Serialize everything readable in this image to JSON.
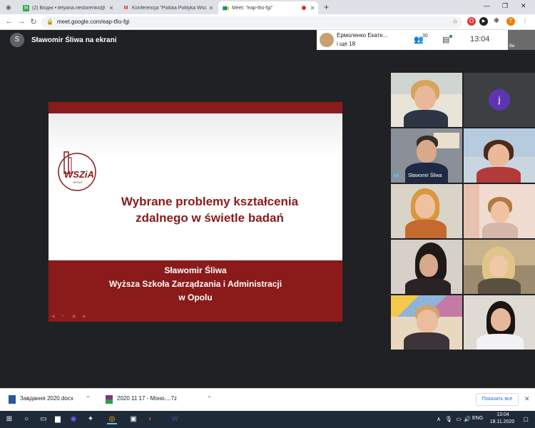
{
  "browser": {
    "tabs": [
      {
        "label": "(2) Вхідні • tetyana.nestorenko@",
        "icon": "mail",
        "active": false
      },
      {
        "label": "Konferencja \"Polska Polityka Wsc",
        "icon": "gmail",
        "active": false
      },
      {
        "label": "Meet: \"eap-tfio-fgi\"",
        "icon": "meet",
        "active": true
      }
    ],
    "url": "meet.google.com/eap-tfio-fgi",
    "profile_initial": "T"
  },
  "meet": {
    "presenter_initial": "S",
    "presenter_label": "Sławomir Śliwa na ekrani",
    "people_name": "Ермоленко Екате...",
    "people_more": "і ще 18",
    "participant_count": "30",
    "clock": "13:04",
    "self_label": "Ви"
  },
  "slide": {
    "logo_text": "WSZiA",
    "logo_sub": "OPOLE",
    "title_line1": "Wybrane problemy kształcenia",
    "title_line2": "zdalnego w świetle badań",
    "author": "Sławomir Śliwa",
    "institution": "Wyższa Szkoła Zarządzania i Administracji",
    "city": "w Opolu"
  },
  "participants": [
    {
      "name": ""
    },
    {
      "name": "",
      "initial": "j"
    },
    {
      "name": "Sławomir Śliwa"
    },
    {
      "name": ""
    },
    {
      "name": ""
    },
    {
      "name": ""
    },
    {
      "name": ""
    },
    {
      "name": ""
    },
    {
      "name": ""
    },
    {
      "name": ""
    }
  ],
  "downloads": {
    "item1": "Завдання 2020.docx",
    "item2": "2020 11 17  - Моно....7z",
    "show_all": "Показать все"
  },
  "taskbar": {
    "lang": "ENG",
    "time": "13:04",
    "date": "18.11.2020"
  }
}
